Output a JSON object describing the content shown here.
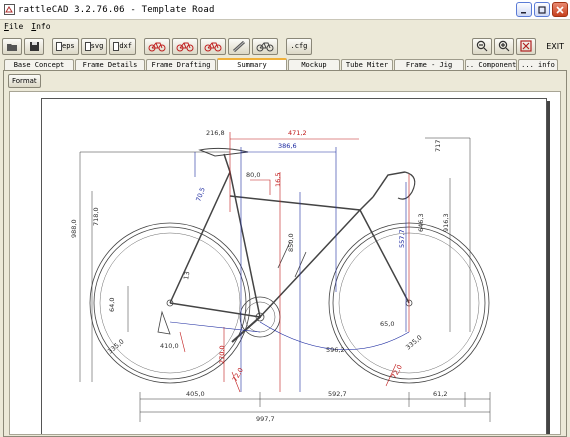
{
  "window": {
    "title": "rattleCAD  3.2.76.06 - Template Road",
    "controls": [
      "minimize-icon",
      "maximize-icon",
      "close-icon"
    ]
  },
  "menu": {
    "file_ul": "F",
    "file_rest": "ile",
    "info_ul": "I",
    "info_rest": "nfo"
  },
  "toolbar": {
    "eps_label": "eps",
    "svg_label": "svg",
    "dxf_label": "dxf",
    "cfg_label": ".cfg",
    "exit_label": "EXIT"
  },
  "tabs": [
    "Base Concept",
    "Frame Details",
    "Frame Drafting",
    "Summary",
    "Mockup",
    "Tube Miter",
    "Frame - Jig",
    "... Components",
    "... info"
  ],
  "active_tab": "Summary",
  "format_button": "Format",
  "dimensions": {
    "d_216_8": "216,8",
    "d_471_2": "471,2",
    "d_386_6": "386,6",
    "d_80_0": "80,0",
    "d_16_5": "16,5",
    "d_70_5": "70,5",
    "d_73_5": "73,5",
    "d_988_0": "988,0",
    "d_718_0": "718,0",
    "d_850_0": "850,0",
    "d_557_7": "557,7",
    "d_646_3": "646,3",
    "d_916_3": "916,3",
    "d_717": "717",
    "d_64_0": "64,0",
    "d_335_0": "335,0",
    "d_410_0": "410,0",
    "d_270_0": "270,0",
    "d_65_0": "65,0",
    "d_596_2": "596,2",
    "d_72_0": "72,0",
    "d_335_b": "335,0",
    "d_405_0": "405,0",
    "d_592_7": "592,7",
    "d_61_2": "61,2",
    "d_997_7": "997,7",
    "d_13": "13"
  },
  "colors": {
    "dim_dark": "#303030",
    "dim_red": "#c01818",
    "dim_blue": "#1c2aa0",
    "frame_line": "#444444",
    "title_close": "#c6401d"
  }
}
